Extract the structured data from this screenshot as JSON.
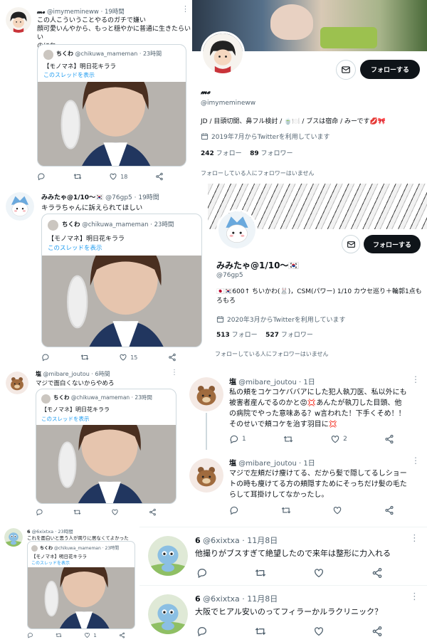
{
  "tweet1": {
    "name": "𝓶𝓮",
    "handle": "@imymemineww",
    "time": "19時間",
    "text_l1": "この人こういうことやるのガチで嫌い",
    "text_l2": "顔可愛いんやから、もっと穏やかに普通に生きたらいい",
    "text_l3": "のにね",
    "quote_name": "ちくわ",
    "quote_handle": "@chikuwa_mameman",
    "quote_time": "23時間",
    "quote_text": "【モノマネ】明日花キララ",
    "quote_thread": "このスレッドを表示",
    "likes": "18"
  },
  "profile1": {
    "follow_label": "フォローする",
    "name": "𝓶𝓮",
    "handle": "@imymemineww",
    "bio": "JD / 目頭切開、鼻フル検討 / 🍵🍽️ / ブスは宿命 / みーです💋🎀",
    "joined": "2019年7月からTwitterを利用しています",
    "following_count": "242",
    "following_label": "フォロー",
    "followers_count": "89",
    "followers_label": "フォロワー",
    "note": "フォローしている人にフォロワーはいません"
  },
  "tweet2": {
    "name": "みみたゃ@1/10〜🇰🇷",
    "handle": "@76gp5",
    "time": "19時間",
    "text": "キララちゃんに訴えられてほしい",
    "quote_name": "ちくわ",
    "quote_handle": "@chikuwa_mameman",
    "quote_time": "23時間",
    "quote_text": "【モノマネ】明日花キララ",
    "quote_thread": "このスレッドを表示",
    "likes": "15"
  },
  "profile2": {
    "follow_label": "フォローする",
    "name": "みみたゃ@1/10〜🇰🇷",
    "handle": "@76gp5",
    "bio_l1": "🇯🇵🇰🇷600↑ ちいかわ(🐰)，CSM(パワー) 1/10 カウセ巡り＋輪郭1点も",
    "bio_l2": "ろもろ",
    "joined": "2020年3月からTwitterを利用しています",
    "following_count": "513",
    "following_label": "フォロー",
    "followers_count": "527",
    "followers_label": "フォロワー",
    "note": "フォローしている人にフォロワーはいません"
  },
  "tweet3": {
    "name": "塩",
    "handle": "@mibare_joutou",
    "time": "6時間",
    "text": "マジで面白くないからやめろ",
    "quote_name": "ちくわ",
    "quote_handle": "@chikuwa_mameman",
    "quote_time": "23時間",
    "quote_text": "【モノマネ】明日花キララ",
    "quote_thread": "このスレッドを表示"
  },
  "tweet4": {
    "name": "塩",
    "handle": "@mibare_joutou",
    "time": "1日",
    "text_l1": "私の頬をコケコケババアにした犯人執刀医、私以外にも",
    "text_l2": "被害者産んでるのかと😡💢あんたが執刀した目頭、他",
    "text_l3": "の病院でやった意味ある？w言われた！下手くそめ！！",
    "text_l4": "そのせいで頬コケを治す羽目に💢",
    "replies": "1",
    "likes": "2"
  },
  "tweet5": {
    "name": "塩",
    "handle": "@mibare_joutou",
    "time": "1日",
    "text_l1": "マジで左頬だけ痩けてる、だから髪で隠してるしショー",
    "text_l2": "トの時も痩けてる方の頬隠すためにそっちだけ髪の毛た",
    "text_l3": "らして耳掛けしてなかったし。"
  },
  "tweet6": {
    "name": "6",
    "handle": "@6xixtxa",
    "time": "23時間",
    "text": "これを面白いと思う人が周りに居なくてよかった",
    "quote_name": "ちくわ",
    "quote_handle": "@chikuwa_mameman",
    "quote_time": "23時間",
    "quote_text": "【モノマネ】明日花キララ",
    "quote_thread": "このスレッドを表示",
    "likes": "1"
  },
  "tweet7": {
    "name": "6",
    "handle": "@6xixtxa",
    "time": "11月8日",
    "text": "他撮りがブスすぎて絶望したので来年は整形に力入れる"
  },
  "tweet8": {
    "name": "6",
    "handle": "@6xixtxa",
    "time": "11月8日",
    "text": "大阪でヒアル安いのってフィラーかルラクリニック？"
  },
  "colors": {
    "text": "#0f1419",
    "muted": "#536471",
    "link": "#1d9bf0",
    "border": "#cfd9de"
  }
}
